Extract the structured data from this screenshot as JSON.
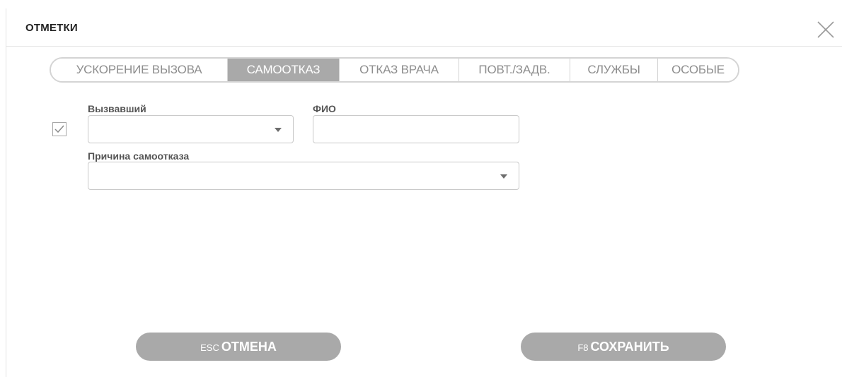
{
  "dialog": {
    "title": "ОТМЕТКИ",
    "close_icon": "close-icon"
  },
  "tabs": [
    {
      "label": "УСКОРЕНИЕ ВЫЗОВА",
      "active": false
    },
    {
      "label": "САМООТКАЗ",
      "active": true
    },
    {
      "label": "ОТКАЗ ВРАЧА",
      "active": false
    },
    {
      "label": "ПОВТ./ЗАДВ.",
      "active": false
    },
    {
      "label": "СЛУЖБЫ",
      "active": false
    },
    {
      "label": "ОСОБЫЕ",
      "active": false
    }
  ],
  "form": {
    "checkbox_checked": true,
    "caller": {
      "label": "Вызвавший",
      "value": ""
    },
    "fio": {
      "label": "ФИО",
      "value": ""
    },
    "reason": {
      "label": "Причина самоотказа",
      "value": ""
    }
  },
  "buttons": {
    "cancel": {
      "key": "ESC",
      "label": "ОТМЕНА"
    },
    "save": {
      "key": "F8",
      "label": "СОХРАНИТЬ"
    }
  },
  "colors": {
    "active_tab": "#a9a9a9",
    "button_bg": "#a9a9a9",
    "tab_text": "#8e8e8e"
  }
}
